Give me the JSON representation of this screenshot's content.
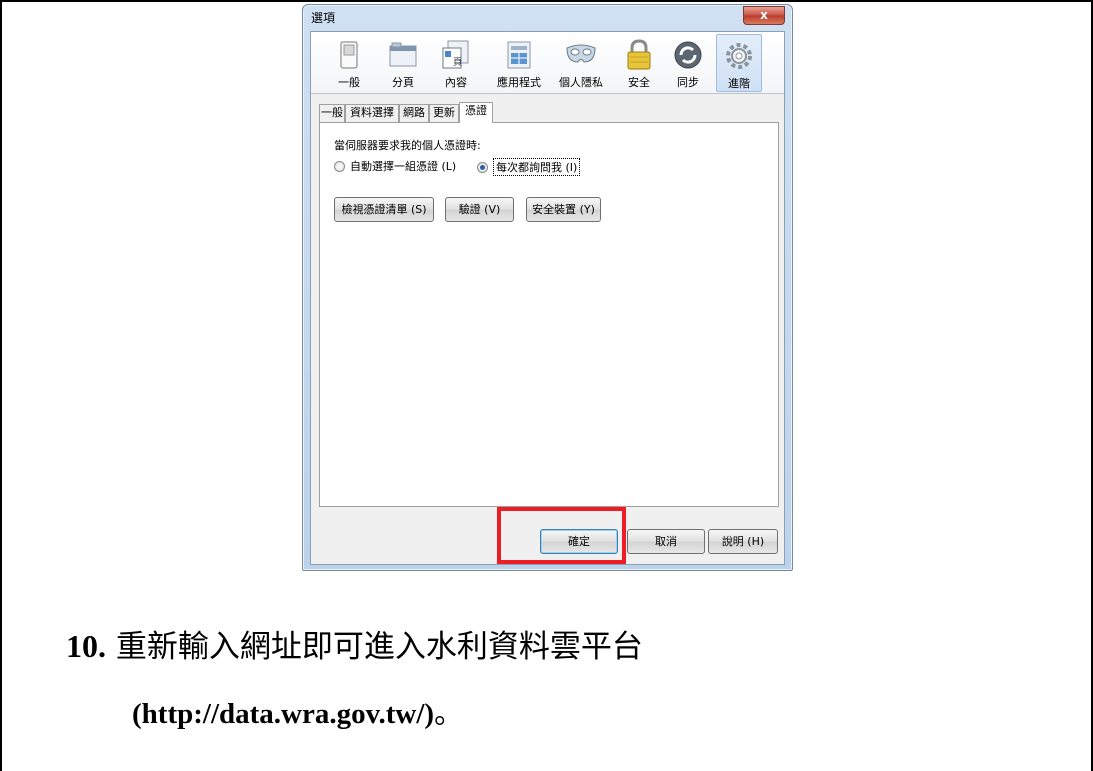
{
  "window": {
    "title": "選項",
    "close_label": "x"
  },
  "toolbar": {
    "items": [
      {
        "label": "一般",
        "icon": "switch-icon"
      },
      {
        "label": "分頁",
        "icon": "tabs-window-icon"
      },
      {
        "label": "內容",
        "icon": "content-page-icon"
      },
      {
        "label": "應用程式",
        "icon": "applications-icon"
      },
      {
        "label": "個人隱私",
        "icon": "privacy-mask-icon"
      },
      {
        "label": "安全",
        "icon": "padlock-icon"
      },
      {
        "label": "同步",
        "icon": "sync-icon"
      },
      {
        "label": "進階",
        "icon": "gear-icon"
      }
    ],
    "active": "進階"
  },
  "tabs": [
    "一般",
    "資料選擇",
    "網路",
    "更新",
    "憑證"
  ],
  "active_tab": "憑證",
  "certificates": {
    "prompt": "當伺服器要求我的個人憑證時:",
    "option_auto": "自動選擇一組憑證 (L)",
    "option_ask": "每次都詢問我 (I)",
    "selected": "每次都詢問我 (I)",
    "view_button": "檢視憑證清單 (S)",
    "validate_button": "驗證 (V)",
    "devices_button": "安全裝置 (Y)"
  },
  "footer": {
    "ok": "確定",
    "cancel": "取消",
    "help": "說明 (H)"
  },
  "colors": {
    "highlight": "#ee1c24",
    "window_frame": "#bcd2ea"
  },
  "document": {
    "step_number": "10.",
    "step_text": "重新輸入網址即可進入水利資料雲平台",
    "url": "(http://data.wra.gov.tw/)",
    "url_tail": "。"
  }
}
